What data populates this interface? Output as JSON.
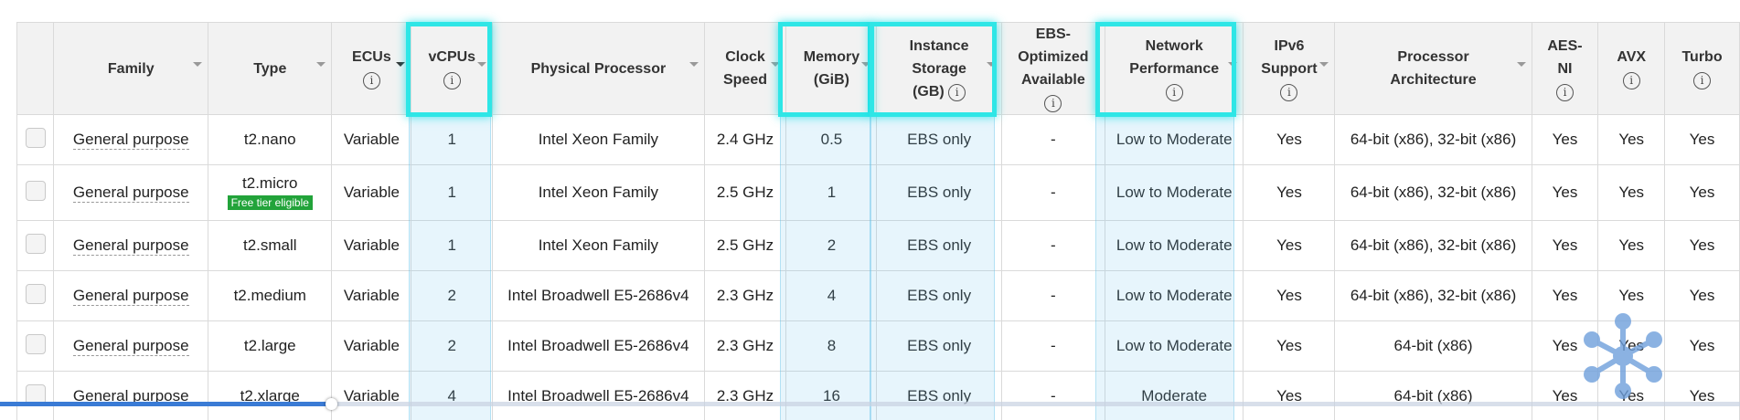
{
  "headers": {
    "family": "Family",
    "type": "Type",
    "ecus": "ECUs",
    "vcpus": "vCPUs",
    "processor": "Physical Processor",
    "clock_l1": "Clock",
    "clock_l2": "Speed",
    "memory_l1": "Memory",
    "memory_l2": "(GiB)",
    "storage_l1": "Instance",
    "storage_l2": "Storage",
    "storage_l3": "(GB)",
    "ebs_l1": "EBS-",
    "ebs_l2": "Optimized",
    "ebs_l3": "Available",
    "network_l1": "Network",
    "network_l2": "Performance",
    "ipv6_l1": "IPv6",
    "ipv6_l2": "Support",
    "arch_l1": "Processor",
    "arch_l2": "Architecture",
    "aes_l1": "AES-",
    "aes_l2": "NI",
    "avx": "AVX",
    "turbo": "Turbo",
    "info_glyph": "i"
  },
  "rows": [
    {
      "family": "General purpose",
      "type": "t2.nano",
      "badge": "",
      "ecus": "Variable",
      "vcpus": "1",
      "processor": "Intel Xeon Family",
      "clock": "2.4 GHz",
      "memory": "0.5",
      "storage": "EBS only",
      "ebs": "-",
      "network": "Low to Moderate",
      "ipv6": "Yes",
      "arch": "64-bit (x86), 32-bit (x86)",
      "aes": "Yes",
      "avx": "Yes",
      "turbo": "Yes"
    },
    {
      "family": "General purpose",
      "type": "t2.micro",
      "badge": "Free tier eligible",
      "ecus": "Variable",
      "vcpus": "1",
      "processor": "Intel Xeon Family",
      "clock": "2.5 GHz",
      "memory": "1",
      "storage": "EBS only",
      "ebs": "-",
      "network": "Low to Moderate",
      "ipv6": "Yes",
      "arch": "64-bit (x86), 32-bit (x86)",
      "aes": "Yes",
      "avx": "Yes",
      "turbo": "Yes"
    },
    {
      "family": "General purpose",
      "type": "t2.small",
      "badge": "",
      "ecus": "Variable",
      "vcpus": "1",
      "processor": "Intel Xeon Family",
      "clock": "2.5 GHz",
      "memory": "2",
      "storage": "EBS only",
      "ebs": "-",
      "network": "Low to Moderate",
      "ipv6": "Yes",
      "arch": "64-bit (x86), 32-bit (x86)",
      "aes": "Yes",
      "avx": "Yes",
      "turbo": "Yes"
    },
    {
      "family": "General purpose",
      "type": "t2.medium",
      "badge": "",
      "ecus": "Variable",
      "vcpus": "2",
      "processor": "Intel Broadwell E5-2686v4",
      "clock": "2.3 GHz",
      "memory": "4",
      "storage": "EBS only",
      "ebs": "-",
      "network": "Low to Moderate",
      "ipv6": "Yes",
      "arch": "64-bit (x86), 32-bit (x86)",
      "aes": "Yes",
      "avx": "Yes",
      "turbo": "Yes"
    },
    {
      "family": "General purpose",
      "type": "t2.large",
      "badge": "",
      "ecus": "Variable",
      "vcpus": "2",
      "processor": "Intel Broadwell E5-2686v4",
      "clock": "2.3 GHz",
      "memory": "8",
      "storage": "EBS only",
      "ebs": "-",
      "network": "Low to Moderate",
      "ipv6": "Yes",
      "arch": "64-bit (x86)",
      "aes": "Yes",
      "avx": "Yes",
      "turbo": "Yes"
    },
    {
      "family": "General purpose",
      "type": "t2.xlarge",
      "badge": "",
      "ecus": "Variable",
      "vcpus": "4",
      "processor": "Intel Broadwell E5-2686v4",
      "clock": "2.3 GHz",
      "memory": "16",
      "storage": "EBS only",
      "ebs": "-",
      "network": "Moderate",
      "ipv6": "Yes",
      "arch": "64-bit (x86)",
      "aes": "Yes",
      "avx": "Yes",
      "turbo": "Yes"
    }
  ],
  "video_progress_fraction": 0.19,
  "colors": {
    "highlight_border": "#2ee6e6",
    "free_tier_badge": "#22a33a",
    "progress": "#3a7bd5"
  }
}
